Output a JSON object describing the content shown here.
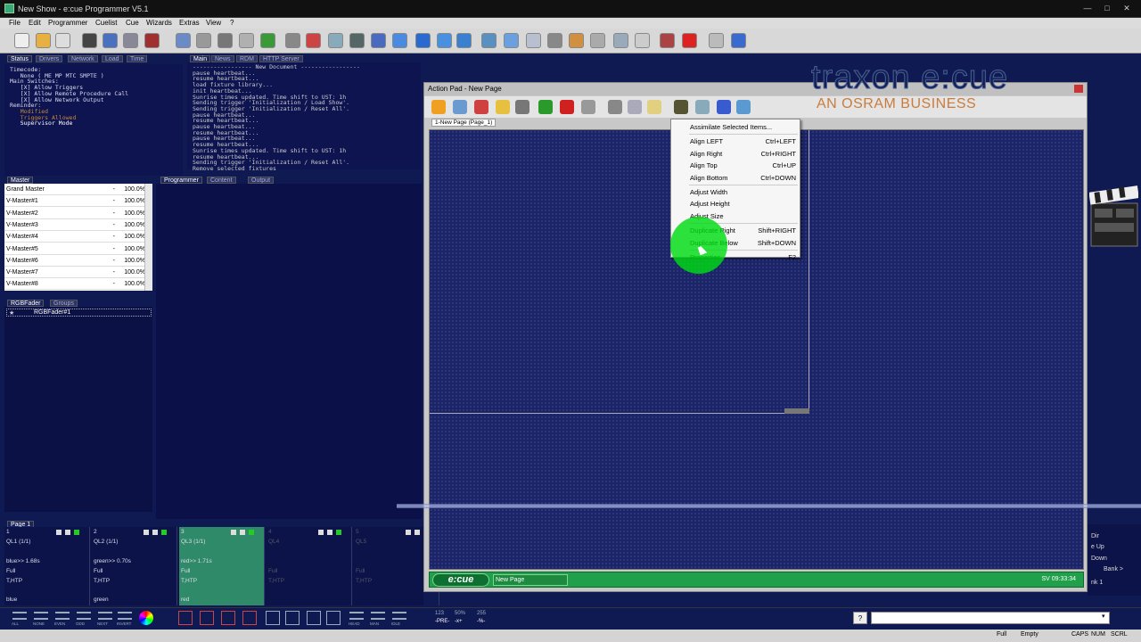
{
  "window": {
    "title": "New Show - e:cue Programmer V5.1"
  },
  "menu": [
    "File",
    "Edit",
    "Programmer",
    "Cuelist",
    "Cue",
    "Wizards",
    "Extras",
    "View",
    "?"
  ],
  "top_tabs": [
    "Status",
    "Drivers",
    "Network",
    "Load",
    "Time"
  ],
  "log_tabs": [
    "Main",
    "News",
    "RDM",
    "HTTP Server"
  ],
  "status_lines": [
    "Timecode:",
    "   None ( ME MP MTC SMPTE )",
    "Main Switches:",
    "   [X] Allow Triggers",
    "   [X] Allow Remote Procedure Call",
    "   [X] Allow Network Output",
    "Reminder:",
    "   Modified",
    "   Triggers Allowed",
    "   Supervisor Mode"
  ],
  "log_lines": [
    "----------------- New Document -----------------",
    "pause heartbeat...",
    "resume heartbeat...",
    "load fixture library...",
    "init heartbeat...",
    "Sunrise times updated. Time shift to UST: 1h",
    "Sending trigger 'Initialization / Load Show'.",
    "Sending trigger 'Initialization / Reset All'.",
    "pause heartbeat...",
    "resume heartbeat...",
    "pause heartbeat...",
    "resume heartbeat...",
    "pause heartbeat...",
    "resume heartbeat...",
    "Sunrise times updated. Time shift to UST: 1h",
    "resume heartbeat...",
    "Sending trigger 'Initialization / Reset All'.",
    "Remove selected fixtures"
  ],
  "master": {
    "tab": "Master",
    "rows": [
      {
        "name": "Grand Master",
        "dash": "-",
        "value": "100.0%"
      },
      {
        "name": "V-Master#1",
        "dash": "-",
        "value": "100.0%"
      },
      {
        "name": "V-Master#2",
        "dash": "-",
        "value": "100.0%"
      },
      {
        "name": "V-Master#3",
        "dash": "-",
        "value": "100.0%"
      },
      {
        "name": "V-Master#4",
        "dash": "-",
        "value": "100.0%"
      },
      {
        "name": "V-Master#5",
        "dash": "-",
        "value": "100.0%"
      },
      {
        "name": "V-Master#6",
        "dash": "-",
        "value": "100.0%"
      },
      {
        "name": "V-Master#7",
        "dash": "-",
        "value": "100.0%"
      },
      {
        "name": "V-Master#8",
        "dash": "-",
        "value": "100.0%"
      }
    ]
  },
  "programmer_tabs": [
    "Programmer",
    "Content",
    "Output"
  ],
  "fader_tabs": [
    "RGBFader",
    "Groups"
  ],
  "fader_item": "RGBFader#1",
  "cue_page_tab": "Page 1",
  "cue_columns": [
    {
      "num": "1",
      "name": "QL1 (1/1)",
      "fade": "blue>> 1.68s",
      "level": "Full",
      "mode": "T,HTP",
      "color": "blue",
      "active": false
    },
    {
      "num": "2",
      "name": "QL2 (1/1)",
      "fade": "green>> 0.70s",
      "level": "Full",
      "mode": "T,HTP",
      "color": "green",
      "active": false
    },
    {
      "num": "3",
      "name": "QL3 (1/1)",
      "fade": "red>> 1.71s",
      "level": "Full",
      "mode": "T,HTP",
      "color": "red",
      "active": true
    },
    {
      "num": "4",
      "name": "QL4",
      "fade": "",
      "level": "Full",
      "mode": "T,HTP",
      "color": "",
      "active": false
    },
    {
      "num": "5",
      "name": "QL5",
      "fade": "",
      "level": "Full",
      "mode": "T,HTP",
      "color": "",
      "active": false
    }
  ],
  "action_pad": {
    "title": "Action Pad - New Page",
    "tab": "1-New Page (Page_1)",
    "logo": "e:cue",
    "page_name": "New Page",
    "sv": "SV 09:33:34"
  },
  "context_menu": [
    {
      "label": "Assimilate Selected Items...",
      "shortcut": "",
      "disabled": false
    },
    {
      "sep": true
    },
    {
      "label": "Align LEFT",
      "shortcut": "Ctrl+LEFT",
      "disabled": false
    },
    {
      "label": "Align Right",
      "shortcut": "Ctrl+RIGHT",
      "disabled": false
    },
    {
      "label": "Align Top",
      "shortcut": "Ctrl+UP",
      "disabled": false
    },
    {
      "label": "Align Bottom",
      "shortcut": "Ctrl+DOWN",
      "disabled": false
    },
    {
      "sep": true
    },
    {
      "label": "Adjust Width",
      "shortcut": "",
      "disabled": false
    },
    {
      "label": "Adjust Height",
      "shortcut": "",
      "disabled": false
    },
    {
      "label": "Adjust Size",
      "shortcut": "",
      "disabled": false
    },
    {
      "sep": true
    },
    {
      "label": "Duplicate Right",
      "shortcut": "Shift+RIGHT",
      "disabled": false
    },
    {
      "label": "Duplicate Below",
      "shortcut": "Shift+DOWN",
      "disabled": false
    },
    {
      "sep": true
    },
    {
      "label": "Properties",
      "shortcut": "F2",
      "disabled": false
    }
  ],
  "brand": {
    "word": "traxon e:cue",
    "sub": "AN OSRAM BUSINESS"
  },
  "right_panel": [
    "Dir",
    "e Up",
    "Down",
    "Bank >",
    "nk 1"
  ],
  "bottom_tools": [
    "ALL",
    "NONE",
    "EVEN",
    "ODD",
    "NEXT",
    "INVERT",
    "HEAD",
    "MAN",
    "IDLE"
  ],
  "bottom_nums": [
    "123",
    "50%",
    "255",
    "-PRE-",
    "-x+",
    "-%-"
  ],
  "bottom_field": "?",
  "status": {
    "full": "Full",
    "empty": "Empty",
    "caps": "CAPS",
    "num": "NUM",
    "scrl": "SCRL"
  },
  "colors": {
    "accent_green": "#20a04a",
    "canvas_bg": "#1b2466",
    "highlight": "#00dc14",
    "brand_orange": "#c97c3d"
  }
}
